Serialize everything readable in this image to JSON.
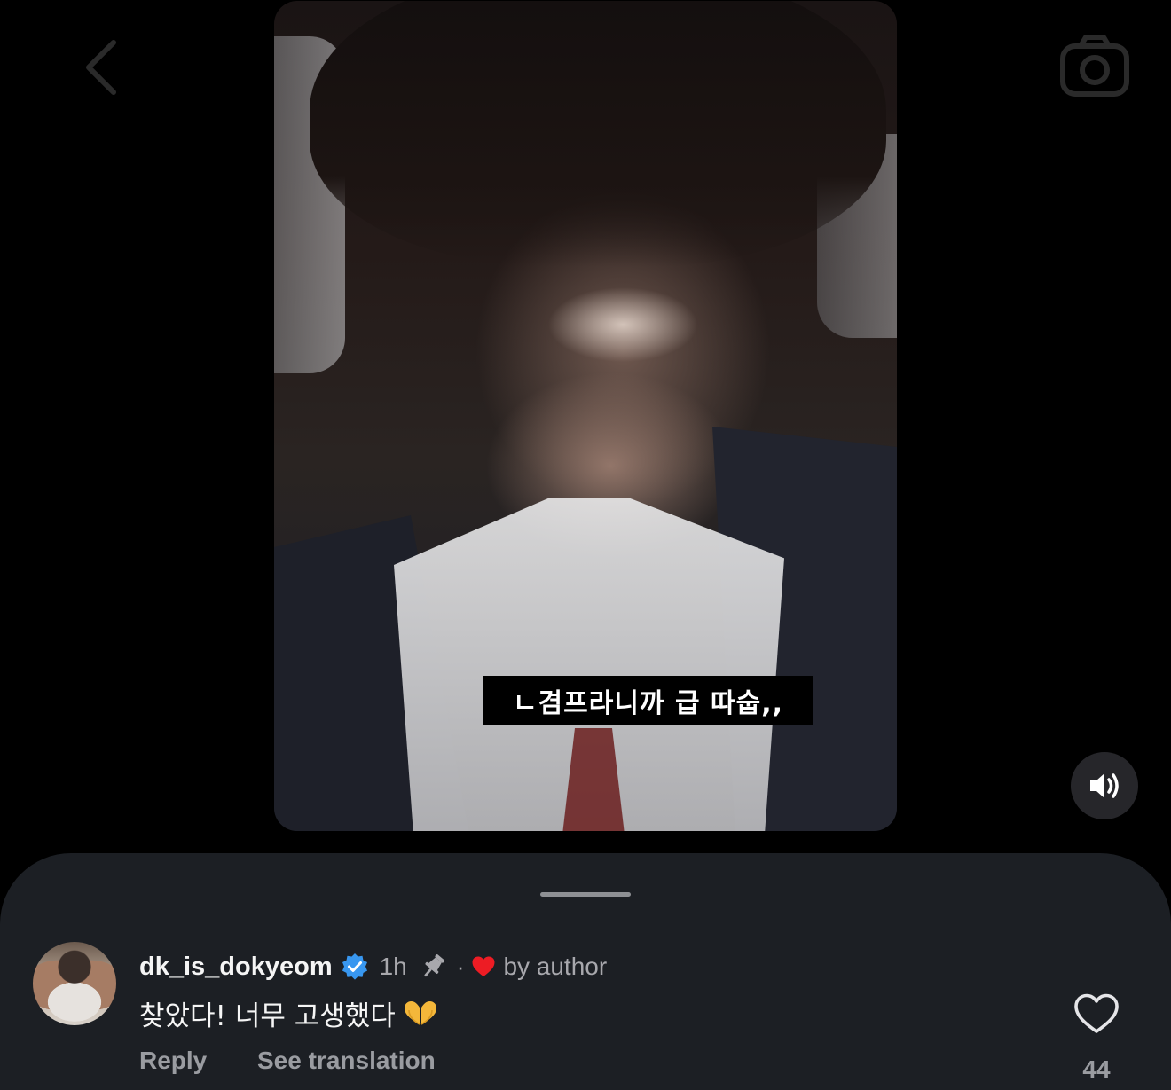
{
  "video": {
    "caption": "ㄴ겸프라니까 급 따숩,,"
  },
  "comment": {
    "username": "dk_is_dokyeom",
    "timestamp": "1h",
    "separator": "·",
    "liked_by_author_label": "by author",
    "text": "찾았다! 너무 고생했다",
    "reply_label": "Reply",
    "translate_label": "See translation",
    "like_count": "44"
  },
  "icons": {
    "back": "chevron-left-icon",
    "camera": "camera-icon",
    "volume": "speaker-icon",
    "verified": "verified-badge-icon",
    "pin": "pin-icon",
    "author_heart": "heart-filled-icon",
    "emoji": "heart-hands-icon",
    "like": "heart-outline-icon"
  },
  "colors": {
    "background": "#000000",
    "sheet": "#1c1f24",
    "verified_blue": "#3897f0",
    "author_heart_red": "#ed1c24",
    "secondary_text": "#a8a8ad"
  }
}
